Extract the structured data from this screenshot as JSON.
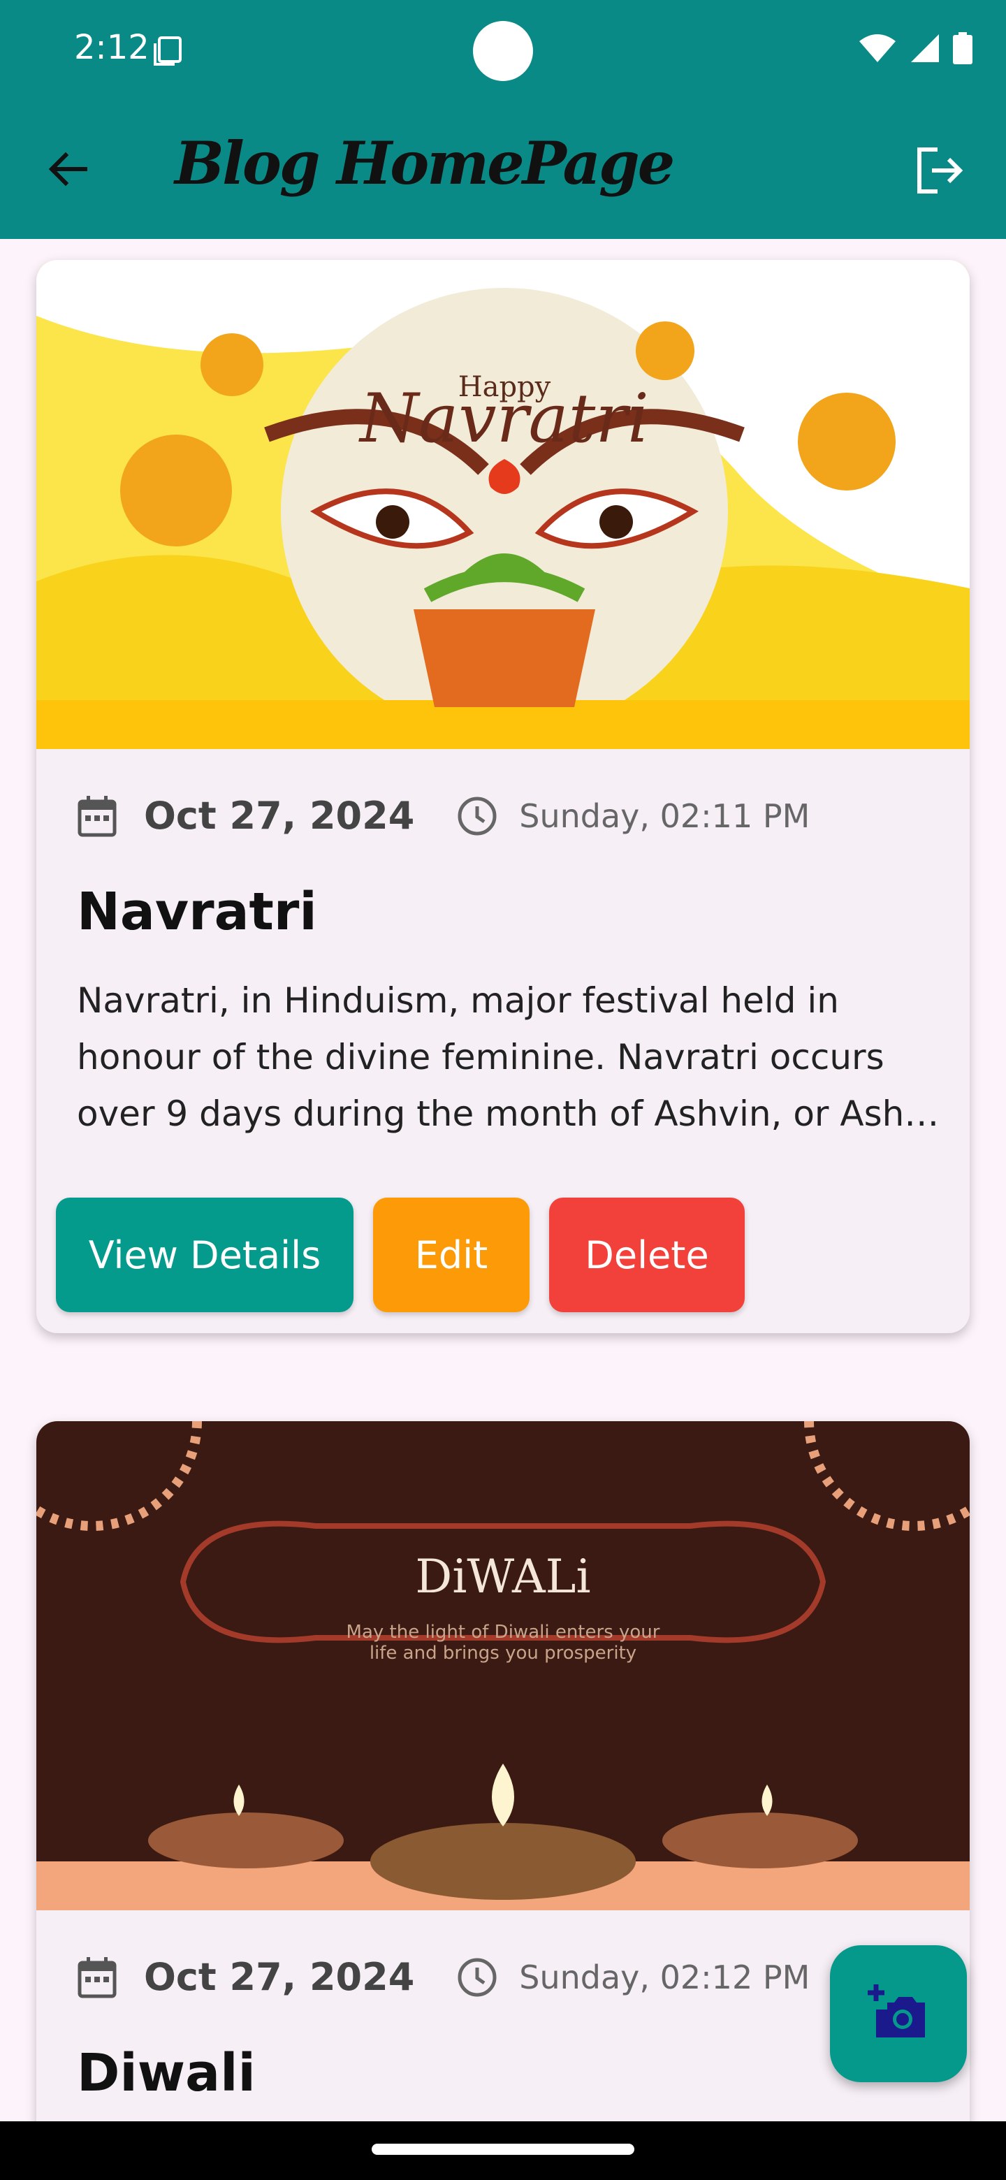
{
  "status_bar": {
    "time": "2:12",
    "background_color": "#0a8a86",
    "icons": [
      "screenshot-icon",
      "wifi-icon",
      "signal-icon",
      "battery-icon"
    ]
  },
  "app_bar": {
    "title": "Blog HomePage",
    "back_icon": "arrow-left-icon",
    "logout_icon": "logout-icon"
  },
  "posts": [
    {
      "image_alt": "Happy Navratri banner",
      "date": "Oct 27, 2024",
      "time": "Sunday, 02:11 PM",
      "title": "Navratri",
      "description_lines": [
        "Navratri, in Hinduism, major festival held in",
        "honour of the divine feminine. Navratri occurs",
        "over 9 days during the month of Ashvin, or Ash…"
      ],
      "buttons": {
        "view": "View Details",
        "edit": "Edit",
        "delete": "Delete"
      }
    },
    {
      "image_alt": "Diwali banner",
      "image_text": "DiWALi",
      "image_subtext_1": "May the light of Diwali enters your",
      "image_subtext_2": "life and brings you prosperity",
      "date": "Oct 27, 2024",
      "time": "Sunday, 02:12 PM",
      "title": "Diwali"
    }
  ],
  "image_text": {
    "navratri_small": "Happy",
    "navratri_big": "Navratri"
  },
  "fab": {
    "icon": "add-photo-icon"
  },
  "colors": {
    "primary": "#0a8a86",
    "view_button": "#049b8c",
    "edit_button": "#fd9a07",
    "delete_button": "#f2413b",
    "fab_icon": "#1a1a8c"
  }
}
